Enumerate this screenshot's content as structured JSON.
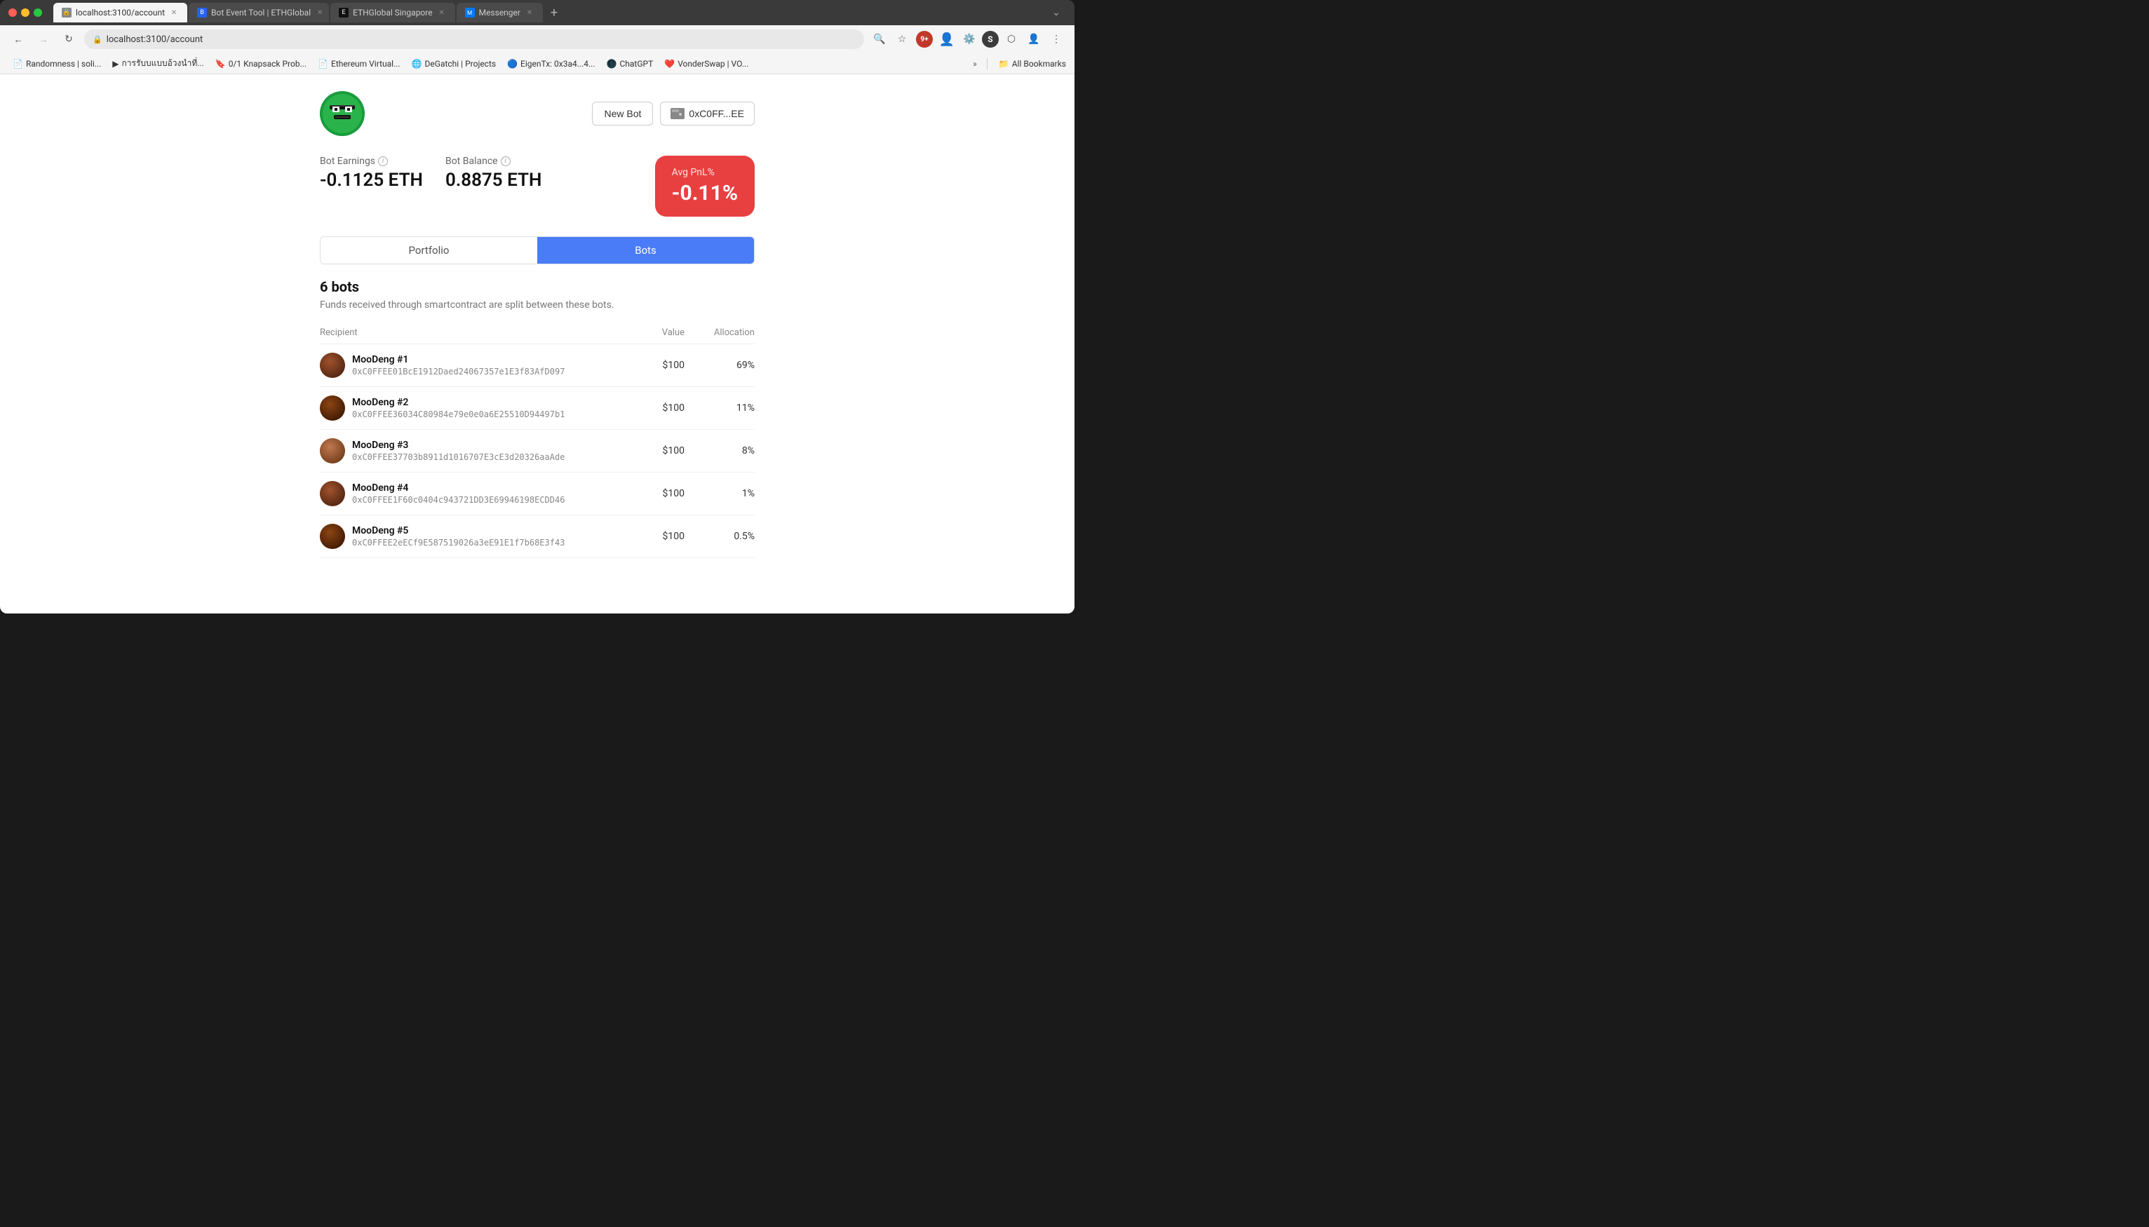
{
  "browser": {
    "tabs": [
      {
        "id": "tab1",
        "label": "localhost:3100/account",
        "favicon": "🔒",
        "active": true
      },
      {
        "id": "tab2",
        "label": "Bot Event Tool | ETHGlobal",
        "favicon": "🌐",
        "active": false
      },
      {
        "id": "tab3",
        "label": "ETHGlobal Singapore",
        "favicon": "🌐",
        "active": false
      },
      {
        "id": "tab4",
        "label": "Messenger",
        "favicon": "💬",
        "active": false
      }
    ],
    "address": "localhost:3100/account",
    "bookmarks": [
      {
        "label": "Randomness | soli..."
      },
      {
        "label": "การรับบแบบอ้วงนำที่..."
      },
      {
        "label": "0/1 Knapsack Prob..."
      },
      {
        "label": "Ethereum Virtual..."
      },
      {
        "label": "DeGatchi | Projects"
      },
      {
        "label": "EigenTx: 0x3a4...4..."
      },
      {
        "label": "ChatGPT"
      },
      {
        "label": "VonderSwap | VO..."
      }
    ],
    "all_bookmarks_label": "All Bookmarks"
  },
  "account": {
    "new_bot_label": "New Bot",
    "wallet_address": "0xC0FF...EE",
    "bot_earnings_label": "Bot Earnings",
    "bot_earnings_value": "-0.1125 ETH",
    "bot_balance_label": "Bot Balance",
    "bot_balance_value": "0.8875 ETH",
    "avg_pnl_label": "Avg PnL%",
    "avg_pnl_value": "-0.11%"
  },
  "tabs": {
    "portfolio_label": "Portfolio",
    "bots_label": "Bots"
  },
  "bots": {
    "count_label": "6 bots",
    "description": "Funds received through smartcontract are split between these bots.",
    "table": {
      "col_recipient": "Recipient",
      "col_value": "Value",
      "col_allocation": "Allocation"
    },
    "items": [
      {
        "name": "MooDeng #1",
        "address": "0xC0FFEE01BcE1912Daed24067357e1E3f83AfD097",
        "value": "$100",
        "allocation": "69%"
      },
      {
        "name": "MooDeng #2",
        "address": "0xC0FFEE36034C80984e79e0e0a6E25510D94497b1",
        "value": "$100",
        "allocation": "11%"
      },
      {
        "name": "MooDeng #3",
        "address": "0xC0FFEE37703b8911d1016707E3cE3d20326aaAde",
        "value": "$100",
        "allocation": "8%"
      },
      {
        "name": "MooDeng #4",
        "address": "0xC0FFEE1F60c0404c943721DD3E69946198ECDD46",
        "value": "$100",
        "allocation": "1%"
      },
      {
        "name": "MooDeng #5",
        "address": "0xC0FFEE2eECf9E587519026a3eE91E1f7b68E3f43",
        "value": "$100",
        "allocation": "0.5%"
      }
    ]
  }
}
